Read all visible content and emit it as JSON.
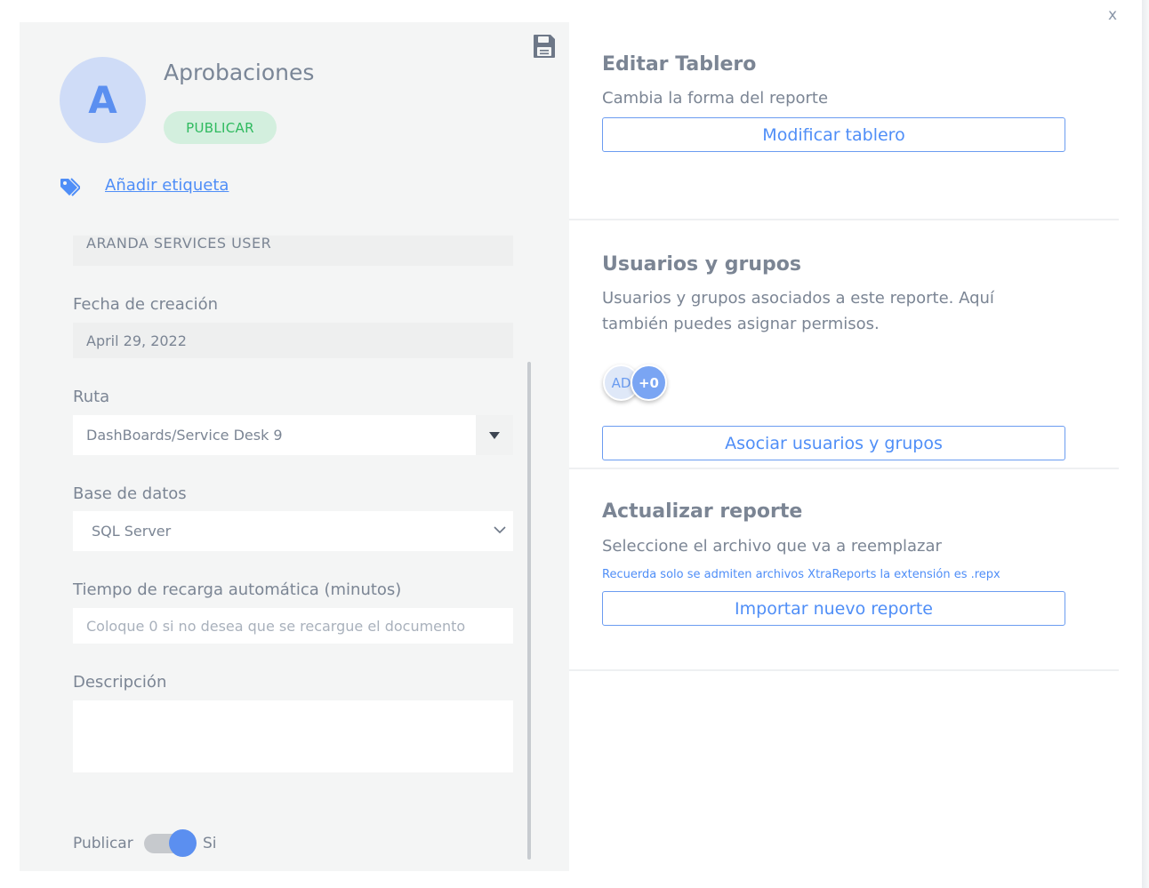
{
  "dialog": {
    "close_label": "x"
  },
  "report": {
    "avatar_letter": "A",
    "title": "Aprobaciones",
    "publish_chip": "PUBLICAR",
    "add_tag_link": "Añadir etiqueta"
  },
  "form": {
    "owner_value_cut": "ARANDA SERVICES USER",
    "creation_date": {
      "label": "Fecha de creación",
      "value": "April 29, 2022"
    },
    "route": {
      "label": "Ruta",
      "value": "DashBoards/Service Desk 9"
    },
    "database": {
      "label": "Base de datos",
      "value": "SQL Server"
    },
    "reload_time": {
      "label": "Tiempo de recarga automática (minutos)",
      "placeholder": "Coloque 0 si no desea que se recargue el documento"
    },
    "description": {
      "label": "Descripción",
      "value": ""
    },
    "publish_toggle": {
      "label": "Publicar",
      "state_label": "Si",
      "on": true
    }
  },
  "edit_board": {
    "title": "Editar Tablero",
    "subtitle": "Cambia la forma del reporte",
    "button": "Modificar tablero"
  },
  "users_groups": {
    "title": "Usuarios y grupos",
    "subtitle": "Usuarios y grupos asociados a este reporte. Aquí también puedes asignar permisos.",
    "avatars": [
      "AD",
      "+0"
    ],
    "button": "Asociar usuarios y grupos"
  },
  "update_report": {
    "title": "Actualizar reporte",
    "subtitle": "Seleccione el archivo que va a reemplazar",
    "note": "Recuerda solo se admiten archivos XtraReports la extensión es .repx",
    "button": "Importar nuevo reporte"
  },
  "colors": {
    "accent": "#4f8ef7",
    "avatar_bg": "#cfdcf7",
    "chip_bg": "#d3efde",
    "chip_text": "#2fba5f",
    "panel_bg": "#f4f5f5"
  }
}
